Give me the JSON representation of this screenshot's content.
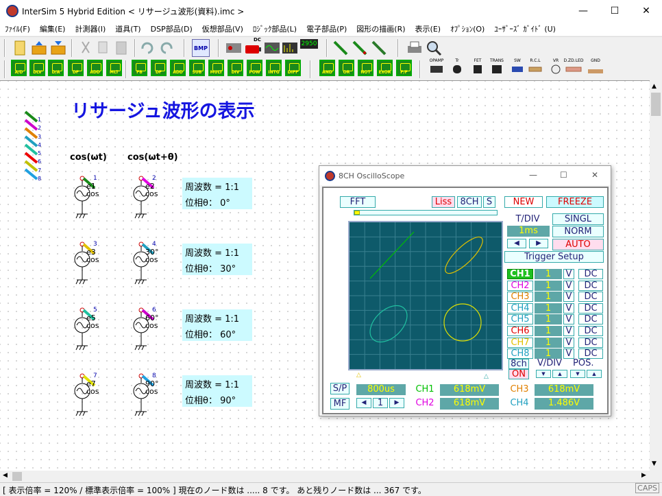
{
  "window": {
    "title": "InterSim 5  Hybrid Edition  < リサージュ波形(資料).imc >",
    "min": "—",
    "max": "☐",
    "close": "✕"
  },
  "menu": [
    "ﾌｧｲﾙ(F)",
    "編集(E)",
    "計測器(I)",
    "道具(T)",
    "DSP部品(D)",
    "仮想部品(V)",
    "ﾛｼﾞｯｸ部品(L)",
    "電子部品(P)",
    "図形の描画(R)",
    "表示(E)",
    "ｵﾌﾟｼｮﾝ(O)",
    "ﾕｰｻﾞｰｽﾞ ｶﾞｲﾄﾞ (U)"
  ],
  "toolbar2": [
    "A/D",
    "DLV",
    "D/A",
    "DF",
    "ADD",
    "MLT",
    "FB",
    "DF",
    "ADD",
    "SUB",
    "MULT",
    "DIV",
    "POW",
    "INTG",
    "DIFF",
    "AND",
    "OR",
    "NOT",
    "ExOR",
    "F/F"
  ],
  "components": [
    "OPAMP",
    "Tr",
    "FET",
    "TRANS",
    "SW",
    "R.C.L",
    "VR",
    "D.ZD.LED",
    "GND"
  ],
  "bmp_label": "BMP",
  "dc_label": "DC",
  "meter_label": "2950",
  "page_title": "リサージュ波形の表示",
  "col_labels": [
    "cos(ωt)",
    "cos(ωt+θ)"
  ],
  "probe_numbers": [
    "1",
    "2",
    "3",
    "4",
    "5",
    "6",
    "7",
    "8"
  ],
  "sources": [
    {
      "l": "e1",
      "r": "e2",
      "lp": "1",
      "rp": "2",
      "phase": "θ=0°"
    },
    {
      "l": "e3",
      "r": "30°",
      "lp": "3",
      "rp": "4",
      "phase": "θ=30°"
    },
    {
      "l": "e5",
      "r": "60°",
      "lp": "5",
      "rp": "6",
      "phase": "θ=60°"
    },
    {
      "l": "e7",
      "r": "90°",
      "lp": "7",
      "rp": "8",
      "phase": "θ=90°"
    }
  ],
  "cos_label": "cos",
  "info": [
    {
      "freq": "周波数 = 1:1",
      "phase": "位相θ：  0°"
    },
    {
      "freq": "周波数 = 1:1",
      "phase": "位相θ：  30°"
    },
    {
      "freq": "周波数 = 1:1",
      "phase": "位相θ：  60°"
    },
    {
      "freq": "周波数 = 1:1",
      "phase": "位相θ：  90°"
    }
  ],
  "scope": {
    "title": "8CH OscilloScope",
    "fft": "FFT",
    "liss": "Liss",
    "ch8": "8CH",
    "s": "S",
    "new": "NEW",
    "freeze": "FREEZE",
    "tdiv": "T/DIV",
    "tdiv_val": "1ms",
    "singl": "SINGL",
    "norm": "NORM",
    "auto": "AUTO",
    "trigger": "Trigger Setup",
    "channels": [
      {
        "name": "CH1",
        "val": "1",
        "v": "V",
        "dc": "DC",
        "color": "#00c000"
      },
      {
        "name": "CH2",
        "val": "1",
        "v": "V",
        "dc": "DC",
        "color": "#e000e0"
      },
      {
        "name": "CH3",
        "val": "1",
        "v": "V",
        "dc": "DC",
        "color": "#e08000"
      },
      {
        "name": "CH4",
        "val": "1",
        "v": "V",
        "dc": "DC",
        "color": "#20a0c0"
      },
      {
        "name": "CH5",
        "val": "1",
        "v": "V",
        "dc": "DC",
        "color": "#20a0c0"
      },
      {
        "name": "CH6",
        "val": "1",
        "v": "V",
        "dc": "DC",
        "color": "#e00000"
      },
      {
        "name": "CH7",
        "val": "1",
        "v": "V",
        "dc": "DC",
        "color": "#e0c000"
      },
      {
        "name": "CH8",
        "val": "1",
        "v": "V",
        "dc": "DC",
        "color": "#20a0c0"
      }
    ],
    "ch8on": "8ch",
    "on": "ON",
    "vdiv": "V/DIV",
    "pos": "POS.",
    "sp": "S/P",
    "mf": "MF",
    "time": "800us",
    "page": "1",
    "readouts": [
      {
        "name": "CH1",
        "val": "618mV",
        "color": "#00c000"
      },
      {
        "name": "CH2",
        "val": "618mV",
        "color": "#e000e0"
      },
      {
        "name": "CH3",
        "val": "618mV",
        "color": "#e08000"
      },
      {
        "name": "CH4",
        "val": "1.486V",
        "color": "#20a0c0"
      }
    ]
  },
  "status": "[ 表示倍率 = 120% / 標準表示倍率 = 100% ] 現在のノード数は ..... 8 です。 あと残りノード数は ... 367 です。",
  "caps": "CAPS"
}
